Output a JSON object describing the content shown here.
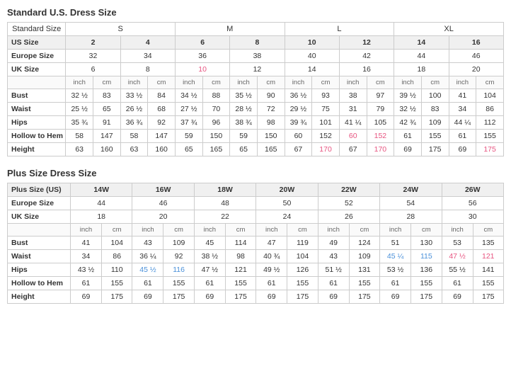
{
  "standard": {
    "title": "Standard U.S. Dress Size",
    "sizeGroups": [
      "S",
      "M",
      "L",
      "XL"
    ],
    "headers": {
      "standardSize": "Standard Size",
      "usSize": "US Size",
      "europeSize": "Europe Size",
      "ukSize": "UK Size"
    },
    "usSizes": [
      "2",
      "4",
      "6",
      "8",
      "10",
      "12",
      "14",
      "16"
    ],
    "europeSizes": [
      "32",
      "34",
      "36",
      "38",
      "40",
      "42",
      "44",
      "46"
    ],
    "ukSizes": [
      "6",
      "8",
      "10",
      "12",
      "14",
      "16",
      "18",
      "20"
    ],
    "measurements": {
      "bust": {
        "label": "Bust",
        "values": [
          "32 ½",
          "83",
          "33 ½",
          "84",
          "34 ½",
          "88",
          "35 ½",
          "90",
          "36 ½",
          "93",
          "38",
          "97",
          "39 ½",
          "100",
          "41",
          "104"
        ]
      },
      "waist": {
        "label": "Waist",
        "values": [
          "25 ½",
          "65",
          "26 ½",
          "68",
          "27 ½",
          "70",
          "28 ½",
          "72",
          "29 ½",
          "75",
          "31",
          "79",
          "32 ½",
          "83",
          "34",
          "86"
        ]
      },
      "hips": {
        "label": "Hips",
        "values": [
          "35 ¾",
          "91",
          "36 ¾",
          "92",
          "37 ¾",
          "96",
          "38 ¾",
          "98",
          "39 ¾",
          "101",
          "41 ¼",
          "105",
          "42 ¾",
          "109",
          "44 ¼",
          "112"
        ]
      },
      "hollowToHem": {
        "label": "Hollow to Hem",
        "values": [
          "58",
          "147",
          "58",
          "147",
          "59",
          "150",
          "59",
          "150",
          "60",
          "152",
          "60",
          "152",
          "61",
          "155",
          "61",
          "155"
        ]
      },
      "height": {
        "label": "Height",
        "values": [
          "63",
          "160",
          "63",
          "160",
          "65",
          "165",
          "65",
          "165",
          "67",
          "170",
          "67",
          "170",
          "69",
          "175",
          "69",
          "175"
        ]
      }
    }
  },
  "plus": {
    "title": "Plus Size Dress Size",
    "sizeGroups": [
      "14W",
      "16W",
      "18W",
      "20W",
      "22W",
      "24W",
      "26W"
    ],
    "headers": {
      "plusSizeUS": "Plus Size (US)",
      "europeSize": "Europe Size",
      "ukSize": "UK Size"
    },
    "europeSizes": [
      "44",
      "46",
      "48",
      "50",
      "52",
      "54",
      "56"
    ],
    "ukSizes": [
      "18",
      "20",
      "22",
      "24",
      "26",
      "28",
      "30"
    ],
    "measurements": {
      "bust": {
        "label": "Bust",
        "values": [
          "41",
          "104",
          "43",
          "109",
          "45",
          "114",
          "47",
          "119",
          "49",
          "124",
          "51",
          "130",
          "53",
          "135"
        ]
      },
      "waist": {
        "label": "Waist",
        "values": [
          "34",
          "86",
          "36 ¼",
          "92",
          "38 ½",
          "98",
          "40 ¾",
          "104",
          "43",
          "109",
          "45 ¼",
          "115",
          "47 ½",
          "121"
        ]
      },
      "hips": {
        "label": "Hips",
        "values": [
          "43 ½",
          "110",
          "45 ½",
          "116",
          "47 ½",
          "121",
          "49 ½",
          "126",
          "51 ½",
          "131",
          "53 ½",
          "136",
          "55 ½",
          "141"
        ]
      },
      "hollowToHem": {
        "label": "Hollow to Hem",
        "values": [
          "61",
          "155",
          "61",
          "155",
          "61",
          "155",
          "61",
          "155",
          "61",
          "155",
          "61",
          "155",
          "61",
          "155"
        ]
      },
      "height": {
        "label": "Height",
        "values": [
          "69",
          "175",
          "69",
          "175",
          "69",
          "175",
          "69",
          "175",
          "69",
          "175",
          "69",
          "175",
          "69",
          "175"
        ]
      }
    }
  }
}
